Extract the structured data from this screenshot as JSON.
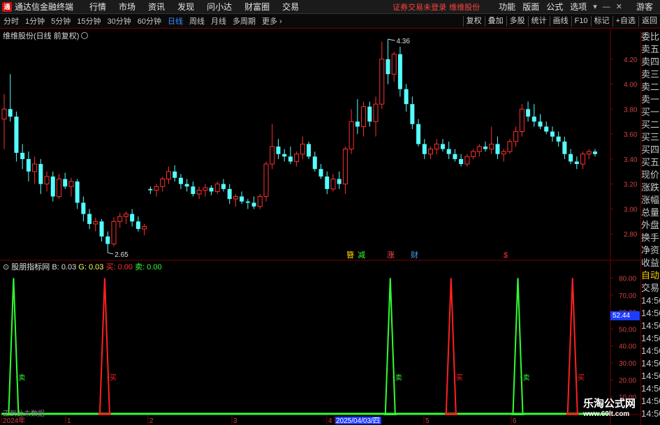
{
  "menubar": {
    "app_title": "通达信金融终端",
    "items": [
      "行情",
      "市场",
      "资讯",
      "发现",
      "问小达",
      "财富圈",
      "交易"
    ],
    "warning": "证券交易未登录",
    "stock_name": "维维股份",
    "right_items": [
      "功能",
      "版面",
      "公式",
      "选项"
    ],
    "guest": "游客"
  },
  "periods": {
    "items": [
      "分时",
      "1分钟",
      "5分钟",
      "15分钟",
      "30分钟",
      "60分钟",
      "日线",
      "周线",
      "月线",
      "多周期",
      "更多"
    ],
    "active": "日线",
    "tools": [
      "复权",
      "叠加",
      "多股",
      "统计",
      "画线",
      "F10",
      "标记",
      "+自选",
      "返回"
    ]
  },
  "main_chart": {
    "label": "维维股份(日线 前复权)",
    "y_ticks": [
      "4.20",
      "4.00",
      "3.80",
      "3.60",
      "3.40",
      "3.20",
      "3.00",
      "2.80"
    ],
    "high_label": "4.36",
    "low_label": "2.65",
    "event_marks": [
      {
        "text": "簪",
        "color": "#ffd400"
      },
      {
        "text": "减",
        "color": "#30ff30"
      },
      {
        "text": "涨",
        "color": "#ff5050"
      },
      {
        "text": "财",
        "color": "#4a9cff"
      },
      {
        "text": "$",
        "color": "#ff3030"
      }
    ]
  },
  "indicator": {
    "name": "股朋指标网",
    "b_label": "B:",
    "b_value": "0.03",
    "g_label": "G:",
    "g_value": "0.03",
    "sell_label": "买:",
    "sell_value": "0.00",
    "buy_label": "卖:",
    "buy_value": "0.00",
    "y_ticks": [
      "80.00",
      "70.00",
      "60.00",
      "50.00",
      "40.00",
      "30.00",
      "20.00",
      "10.00"
    ],
    "current_value": "52.44",
    "signal_labels": {
      "sell": "卖",
      "buy": "买"
    },
    "hint": "正到此未数据"
  },
  "x_axis": {
    "labels": [
      "2024年",
      "1",
      "2",
      "3",
      "4",
      "2025/04/03/四",
      "5",
      "6"
    ]
  },
  "right_panel": {
    "top_items": [
      "委比",
      "卖五",
      "卖四",
      "卖三",
      "卖二",
      "卖一",
      "买一",
      "买二",
      "买三",
      "买四",
      "买五",
      "现价",
      "涨跌",
      "涨幅",
      "总量",
      "外盘",
      "换手",
      "净资",
      "收益"
    ],
    "lower_items": [
      "自动",
      "交易",
      "14:56",
      "14:56",
      "14:56",
      "14:56",
      "14:56",
      "14:56",
      "14:56",
      "14:56",
      "14:56",
      "14:56"
    ]
  },
  "watermark": {
    "line1": "乐淘公式网",
    "line2": "www.60lt.com"
  },
  "colors": {
    "up": "#ff3030",
    "down": "#54ffff",
    "green_signal": "#30ff30",
    "red_signal": "#ff2020",
    "axis": "#7a0000"
  },
  "chart_data": {
    "type": "candlestick",
    "ylim": [
      2.6,
      4.4
    ],
    "ohlc": [
      [
        3.72,
        3.92,
        3.48,
        3.8
      ],
      [
        3.8,
        4.08,
        3.7,
        3.74
      ],
      [
        3.74,
        3.78,
        3.38,
        3.45
      ],
      [
        3.45,
        3.52,
        3.32,
        3.4
      ],
      [
        3.4,
        3.46,
        3.22,
        3.3
      ],
      [
        3.3,
        3.42,
        3.2,
        3.36
      ],
      [
        3.36,
        3.4,
        3.12,
        3.2
      ],
      [
        3.2,
        3.3,
        3.14,
        3.26
      ],
      [
        3.26,
        3.3,
        3.06,
        3.1
      ],
      [
        3.1,
        3.28,
        3.08,
        3.24
      ],
      [
        3.24,
        3.29,
        3.16,
        3.18
      ],
      [
        3.18,
        3.25,
        3.1,
        3.22
      ],
      [
        3.22,
        3.24,
        3.0,
        3.05
      ],
      [
        3.05,
        3.1,
        2.9,
        2.96
      ],
      [
        2.96,
        3.0,
        2.84,
        2.88
      ],
      [
        2.88,
        2.93,
        2.82,
        2.9
      ],
      [
        2.9,
        2.92,
        2.74,
        2.78
      ],
      [
        2.78,
        2.82,
        2.65,
        2.72
      ],
      [
        2.72,
        2.93,
        2.7,
        2.9
      ],
      [
        2.9,
        2.97,
        2.85,
        2.94
      ],
      [
        2.94,
        2.98,
        2.88,
        2.96
      ],
      [
        2.96,
        3.0,
        2.86,
        2.9
      ],
      [
        2.9,
        2.94,
        2.82,
        2.84
      ],
      [
        2.84,
        2.88,
        2.79,
        2.86
      ],
      [
        3.16,
        3.18,
        3.12,
        3.15
      ],
      [
        3.15,
        3.2,
        3.1,
        3.18
      ],
      [
        3.18,
        3.26,
        3.14,
        3.24
      ],
      [
        3.24,
        3.34,
        3.2,
        3.3
      ],
      [
        3.3,
        3.35,
        3.22,
        3.25
      ],
      [
        3.25,
        3.28,
        3.16,
        3.2
      ],
      [
        3.2,
        3.24,
        3.14,
        3.18
      ],
      [
        3.18,
        3.22,
        3.1,
        3.12
      ],
      [
        3.12,
        3.18,
        3.08,
        3.15
      ],
      [
        3.15,
        3.2,
        3.1,
        3.17
      ],
      [
        3.17,
        3.19,
        3.11,
        3.14
      ],
      [
        3.14,
        3.22,
        3.12,
        3.2
      ],
      [
        3.2,
        3.24,
        3.14,
        3.16
      ],
      [
        3.16,
        3.2,
        3.04,
        3.08
      ],
      [
        3.08,
        3.12,
        3.02,
        3.1
      ],
      [
        3.1,
        3.14,
        3.04,
        3.06
      ],
      [
        3.06,
        3.08,
        3.0,
        3.05
      ],
      [
        3.05,
        3.1,
        3.0,
        3.02
      ],
      [
        3.02,
        3.12,
        3.0,
        3.1
      ],
      [
        3.1,
        3.38,
        3.06,
        3.36
      ],
      [
        3.36,
        3.68,
        3.32,
        3.5
      ],
      [
        3.5,
        3.56,
        3.4,
        3.44
      ],
      [
        3.44,
        3.48,
        3.38,
        3.42
      ],
      [
        3.42,
        3.5,
        3.36,
        3.38
      ],
      [
        3.38,
        3.46,
        3.34,
        3.44
      ],
      [
        3.44,
        3.58,
        3.4,
        3.52
      ],
      [
        3.52,
        3.54,
        3.4,
        3.42
      ],
      [
        3.42,
        3.46,
        3.3,
        3.32
      ],
      [
        3.32,
        3.36,
        3.24,
        3.26
      ],
      [
        3.26,
        3.3,
        3.12,
        3.16
      ],
      [
        3.16,
        3.28,
        3.14,
        3.24
      ],
      [
        3.24,
        3.3,
        3.16,
        3.2
      ],
      [
        3.2,
        3.5,
        3.12,
        3.48
      ],
      [
        3.48,
        3.8,
        3.44,
        3.7
      ],
      [
        3.7,
        3.88,
        3.6,
        3.66
      ],
      [
        3.66,
        3.86,
        3.58,
        3.82
      ],
      [
        3.82,
        3.86,
        3.66,
        3.7
      ],
      [
        3.7,
        3.9,
        3.58,
        3.84
      ],
      [
        3.84,
        4.34,
        3.8,
        4.2
      ],
      [
        4.2,
        4.36,
        4.0,
        4.08
      ],
      [
        4.08,
        4.26,
        4.02,
        4.24
      ],
      [
        4.24,
        4.3,
        3.9,
        3.96
      ],
      [
        3.96,
        4.0,
        3.78,
        3.84
      ],
      [
        3.84,
        3.9,
        3.64,
        3.68
      ],
      [
        3.68,
        3.72,
        3.5,
        3.52
      ],
      [
        3.52,
        3.56,
        3.4,
        3.44
      ],
      [
        3.44,
        3.5,
        3.4,
        3.48
      ],
      [
        3.48,
        3.56,
        3.44,
        3.52
      ],
      [
        3.52,
        3.56,
        3.46,
        3.48
      ],
      [
        3.48,
        3.54,
        3.4,
        3.44
      ],
      [
        3.44,
        3.48,
        3.38,
        3.4
      ],
      [
        3.4,
        3.44,
        3.34,
        3.36
      ],
      [
        3.36,
        3.44,
        3.34,
        3.42
      ],
      [
        3.42,
        3.48,
        3.4,
        3.46
      ],
      [
        3.46,
        3.52,
        3.42,
        3.5
      ],
      [
        3.5,
        3.54,
        3.46,
        3.48
      ],
      [
        3.48,
        3.66,
        3.44,
        3.52
      ],
      [
        3.52,
        3.58,
        3.4,
        3.44
      ],
      [
        3.44,
        3.48,
        3.38,
        3.46
      ],
      [
        3.46,
        3.56,
        3.44,
        3.54
      ],
      [
        3.54,
        3.66,
        3.5,
        3.62
      ],
      [
        3.62,
        3.84,
        3.58,
        3.8
      ],
      [
        3.8,
        3.86,
        3.7,
        3.74
      ],
      [
        3.74,
        3.84,
        3.66,
        3.7
      ],
      [
        3.7,
        3.76,
        3.64,
        3.66
      ],
      [
        3.66,
        3.7,
        3.6,
        3.62
      ],
      [
        3.62,
        3.66,
        3.54,
        3.58
      ],
      [
        3.58,
        3.62,
        3.5,
        3.54
      ],
      [
        3.54,
        3.58,
        3.4,
        3.44
      ],
      [
        3.44,
        3.48,
        3.36,
        3.38
      ],
      [
        3.38,
        3.42,
        3.32,
        3.36
      ],
      [
        3.36,
        3.46,
        3.32,
        3.44
      ],
      [
        3.44,
        3.48,
        3.4,
        3.46
      ],
      [
        3.46,
        3.48,
        3.42,
        3.44
      ]
    ],
    "indicator_series": [
      {
        "name": "卖",
        "color": "#30ff30",
        "peaks": [
          {
            "x": 0.02,
            "y": 80
          },
          {
            "x": 0.64,
            "y": 80
          },
          {
            "x": 0.85,
            "y": 80
          }
        ]
      },
      {
        "name": "买",
        "color": "#ff2020",
        "peaks": [
          {
            "x": 0.17,
            "y": 80
          },
          {
            "x": 0.74,
            "y": 80
          },
          {
            "x": 0.94,
            "y": 80
          }
        ]
      }
    ],
    "indicator_ylim": [
      0,
      88
    ]
  }
}
